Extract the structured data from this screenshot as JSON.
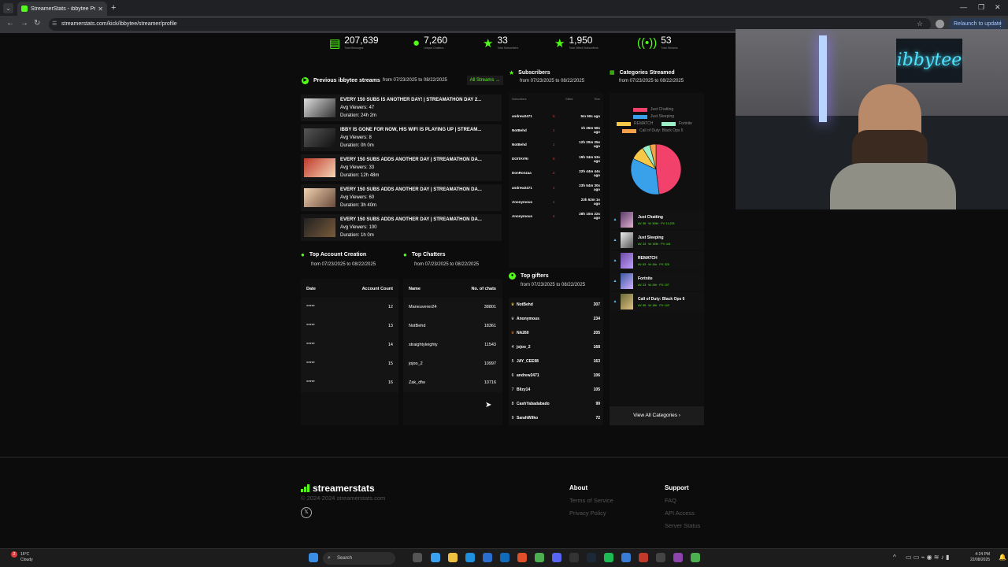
{
  "browser": {
    "tab_title": "StreamerStats - ibbytee Profile",
    "url": "streamerstats.com/kick/ibbytee/streamer/profile",
    "relaunch": "Relaunch to update"
  },
  "stats": [
    {
      "value": "207,639",
      "label": "Total Messages",
      "icon": "chat-icon"
    },
    {
      "value": "7,260",
      "label": "Unique Chatters",
      "icon": "user-icon"
    },
    {
      "value": "33",
      "label": "Total Subscribers",
      "icon": "star-icon"
    },
    {
      "value": "1,950",
      "label": "Total Gifted Subscribers",
      "icon": "star-icon"
    },
    {
      "value": "53",
      "label": "Total Streams",
      "icon": "broadcast-icon"
    }
  ],
  "streams": {
    "title": "Previous ibbytee streams",
    "range": "from 07/23/2025 to 08/22/2025",
    "all_button": "All Streams",
    "items": [
      {
        "title": "EVERY 150 SUBS IS ANOTHER DAY! | STREAMATHON DAY 2...",
        "viewers": "Avg Viewers: 47",
        "duration": "Duration: 24h 2m"
      },
      {
        "title": "IBBY IS GONE FOR NOW, HIS WIFI IS PLAYING UP | STREAM...",
        "viewers": "Avg Viewers: 8",
        "duration": "Duration: 0h 0m"
      },
      {
        "title": "EVERY 150 SUBS ADDS ANOTHER DAY | STREAMATHON DA...",
        "viewers": "Avg Viewers: 33",
        "duration": "Duration: 12h 48m"
      },
      {
        "title": "EVERY 150 SUBS ADDS ANOTHER DAY | STREAMATHON DA...",
        "viewers": "Avg Viewers: 60",
        "duration": "Duration: 3h 40m"
      },
      {
        "title": "EVERY 150 SUBS ADDS ANOTHER DAY | STREAMATHON DA...",
        "viewers": "Avg Viewers: 100",
        "duration": "Duration: 1h 0m"
      }
    ]
  },
  "subscribers": {
    "title": "Subscribers",
    "range": "from 07/23/2025 to 08/22/2025",
    "headers": [
      "Subscribers",
      "Gifted",
      "Time"
    ],
    "rows": [
      {
        "name": "andrew2471",
        "gifted": "5",
        "time": "5m 50s ago"
      },
      {
        "name": "NotBehd",
        "gifted": "1",
        "time": "1h 25m 56s ago"
      },
      {
        "name": "NotBehd",
        "gifted": "1",
        "time": "12h 20m 25s ago"
      },
      {
        "name": "DOITAYRI",
        "gifted": "5",
        "time": "19h 34m 53s ago"
      },
      {
        "name": "DonRonzaa",
        "gifted": "2",
        "time": "22h 44m 44s ago"
      },
      {
        "name": "andrew2471",
        "gifted": "1",
        "time": "23h 54m 30s ago"
      },
      {
        "name": "Anonymous",
        "gifted": "1",
        "time": "23h 52m 1s ago"
      },
      {
        "name": "Anonymous",
        "gifted": "4",
        "time": "28h 10m 22s ago"
      }
    ]
  },
  "gifters": {
    "title": "Top gifters",
    "range": "from 07/23/2025 to 08/22/2025",
    "rows": [
      {
        "rank": "1",
        "name": "NotBehd",
        "value": "307"
      },
      {
        "rank": "2",
        "name": "Anonymous",
        "value": "234"
      },
      {
        "rank": "3",
        "name": "NA260",
        "value": "205"
      },
      {
        "rank": "4",
        "name": "jojoo_2",
        "value": "168"
      },
      {
        "rank": "5",
        "name": "JAY_CEE98",
        "value": "163"
      },
      {
        "rank": "6",
        "name": "andrew2471",
        "value": "106"
      },
      {
        "rank": "7",
        "name": "Blizy14",
        "value": "105"
      },
      {
        "rank": "8",
        "name": "CashYabadabado",
        "value": "99"
      },
      {
        "rank": "9",
        "name": "SarahWilko",
        "value": "72"
      }
    ]
  },
  "categories": {
    "title": "Categories Streamed",
    "range": "from 07/23/2025 to 08/22/2025",
    "legend": [
      {
        "name": "Just Chatting",
        "color": "#f2416b"
      },
      {
        "name": "Just Sleeping",
        "color": "#39a0ea"
      },
      {
        "name": "REMATCH",
        "color": "#f5c84a"
      },
      {
        "name": "Fortnite",
        "color": "#9cf0c8"
      },
      {
        "name": "Call of Duty: Black Ops 6",
        "color": "#f5a04a"
      }
    ],
    "items": [
      {
        "name": "Just Chatting",
        "stats": "AV: 58 · W: 309h · PV: 14,203"
      },
      {
        "name": "Just Sleeping",
        "stats": "AV: 33 · W: 193h · PV: 441"
      },
      {
        "name": "REMATCH",
        "stats": "AV: 63 · W: 44h · PV: 325"
      },
      {
        "name": "Fortnite",
        "stats": "AV: 33 · W: 24h · PV: 107"
      },
      {
        "name": "Call of Duty: Black Ops 6",
        "stats": "AV: 68 · W: 18h · PV: 143"
      }
    ],
    "view_all": "View All Categories"
  },
  "chart_data": {
    "type": "pie",
    "categories": [
      "Just Chatting",
      "Just Sleeping",
      "REMATCH",
      "Fortnite",
      "Call of Duty: Black Ops 6"
    ],
    "values": [
      48,
      34,
      9,
      5,
      4
    ],
    "colors": [
      "#f2416b",
      "#39a0ea",
      "#f5c84a",
      "#9cf0c8",
      "#f5a04a"
    ]
  },
  "account_creation": {
    "title": "Top Account Creation",
    "range": "from 07/23/2025 to 08/22/2025",
    "headers": [
      "Date",
      "Account Count"
    ],
    "rows": [
      {
        "date": "*****",
        "count": "12"
      },
      {
        "date": "*****",
        "count": "13"
      },
      {
        "date": "*****",
        "count": "14"
      },
      {
        "date": "*****",
        "count": "15"
      },
      {
        "date": "*****",
        "count": "16"
      }
    ]
  },
  "chatters": {
    "title": "Top Chatters",
    "range": "from 07/23/2025 to 08/22/2025",
    "headers": [
      "Name",
      "No. of chats"
    ],
    "rows": [
      {
        "name": "Maneuverer24",
        "count": "38801"
      },
      {
        "name": "NotBehd",
        "count": "18361"
      },
      {
        "name": "straightyleighty",
        "count": "11543"
      },
      {
        "name": "jojoo_2",
        "count": "10997"
      },
      {
        "name": "Zak_dfw",
        "count": "10716"
      }
    ]
  },
  "footer": {
    "logo": "streamerstats",
    "copyright": "© 2024-2024 streamerstats.com",
    "about": {
      "heading": "About",
      "links": [
        "Terms of Service",
        "Privacy Policy"
      ]
    },
    "support": {
      "heading": "Support",
      "links": [
        "FAQ",
        "API Access",
        "Server Status"
      ]
    }
  },
  "webcam": {
    "sign": "ibbytee"
  },
  "taskbar": {
    "weather_temp": "16°C",
    "weather_desc": "Cloudy",
    "weather_badge": "2",
    "search": "Search",
    "time": "4:24 PM",
    "date": "22/08/2025"
  }
}
